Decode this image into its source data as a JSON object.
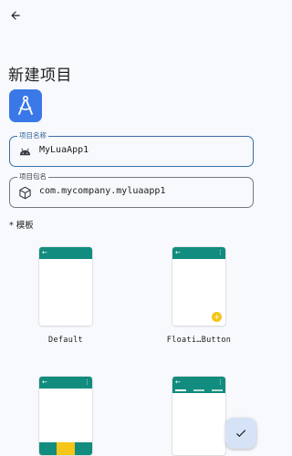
{
  "page": {
    "title": "新建项目",
    "back_icon": "arrow-back-icon",
    "logo_icon": "android-studio-compass-icon",
    "accent_color": "#3b78e7"
  },
  "project_name": {
    "label": "项目名称",
    "value": "MyLuaApp1",
    "icon": "android-icon"
  },
  "package_name": {
    "label": "项目包名",
    "value": "com.mycompany.myluaapp1",
    "icon": "package-icon"
  },
  "templates": {
    "section_label": "* 模板",
    "toolbar_color": "#128c7e",
    "fab_color": "#f5c518",
    "items": [
      {
        "name": "Default"
      },
      {
        "name": "Floati…Button"
      },
      {
        "name": ""
      },
      {
        "name": ""
      }
    ]
  },
  "confirm_button": {
    "icon": "check-icon"
  }
}
